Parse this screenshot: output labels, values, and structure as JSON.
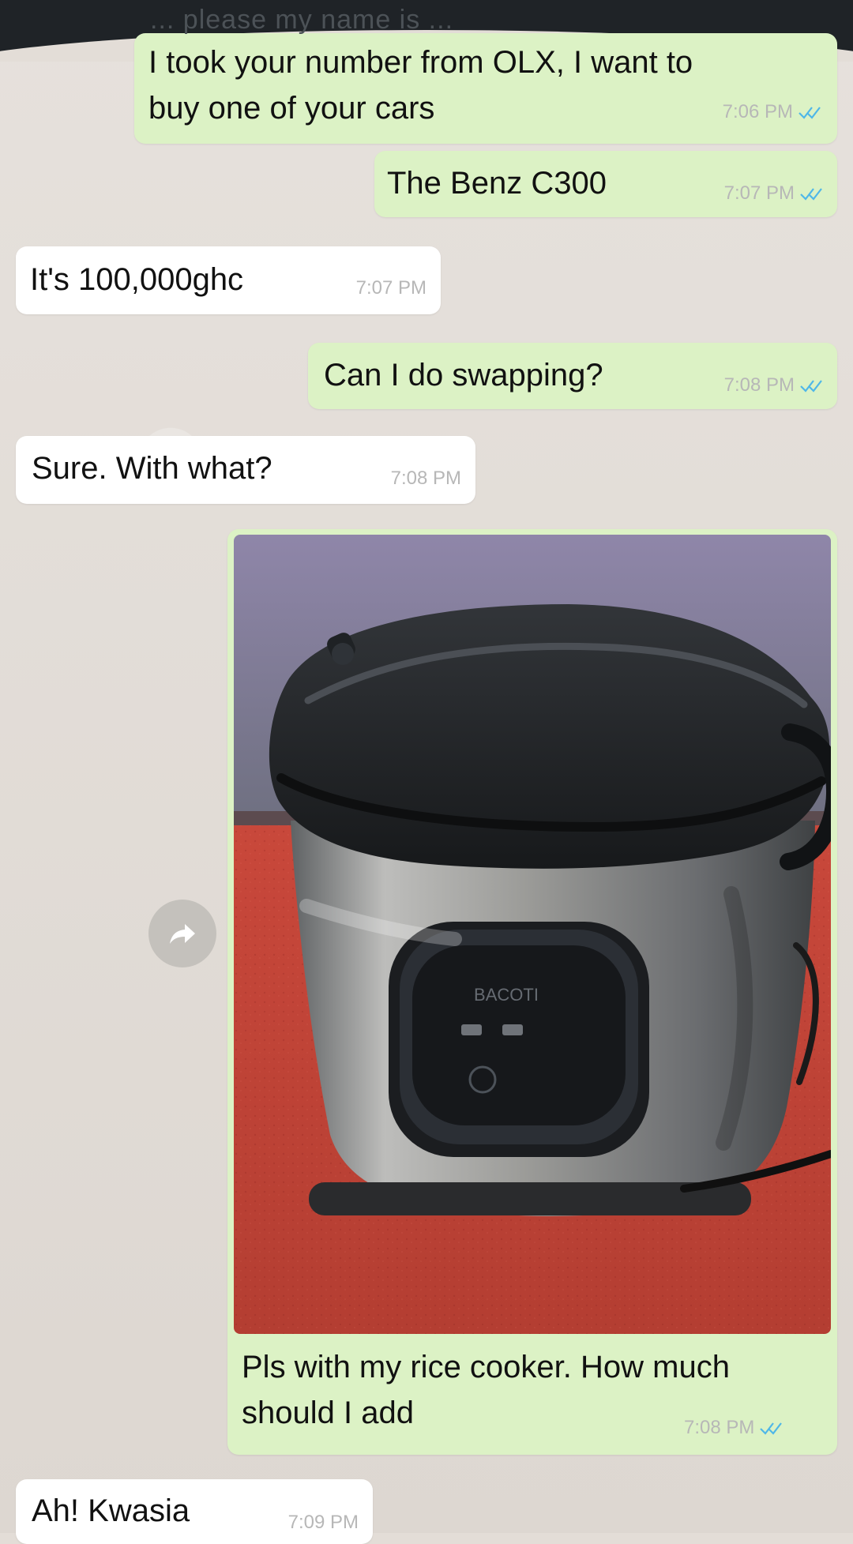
{
  "header": {
    "cut_text": "... please my name is ..."
  },
  "messages": [
    {
      "id": "m1",
      "direction": "outgoing",
      "text_line1": "I took your number from OLX, I want to",
      "text_line2": "buy one of your cars",
      "time": "7:06 PM",
      "status": "read"
    },
    {
      "id": "m2",
      "direction": "outgoing",
      "text": "The Benz C300",
      "time": "7:07 PM",
      "status": "read"
    },
    {
      "id": "m3",
      "direction": "incoming",
      "text": "It's 100,000ghc",
      "time": "7:07 PM"
    },
    {
      "id": "m4",
      "direction": "outgoing",
      "text": "Can I do swapping?",
      "time": "7:08 PM",
      "status": "read"
    },
    {
      "id": "m5",
      "direction": "incoming",
      "text": "Sure.  With what?",
      "time": "7:08 PM"
    },
    {
      "id": "m6",
      "direction": "outgoing",
      "image_label": "rice cooker photo",
      "brand_text": "BACOTI",
      "caption_line1": "Pls with my rice cooker. How much",
      "caption_line2": "should I add",
      "time": "7:08 PM",
      "status": "read"
    },
    {
      "id": "m7",
      "direction": "incoming",
      "text": "Ah!  Kwasia",
      "time": "7:09 PM"
    }
  ],
  "icons": {
    "read_receipt": "double-check-icon",
    "forward": "forward-icon"
  },
  "colors": {
    "outgoing_bubble": "#dcf2c5",
    "incoming_bubble": "#ffffff",
    "tick_blue": "#4fb7e8",
    "chat_background": "#e3ddd7"
  }
}
